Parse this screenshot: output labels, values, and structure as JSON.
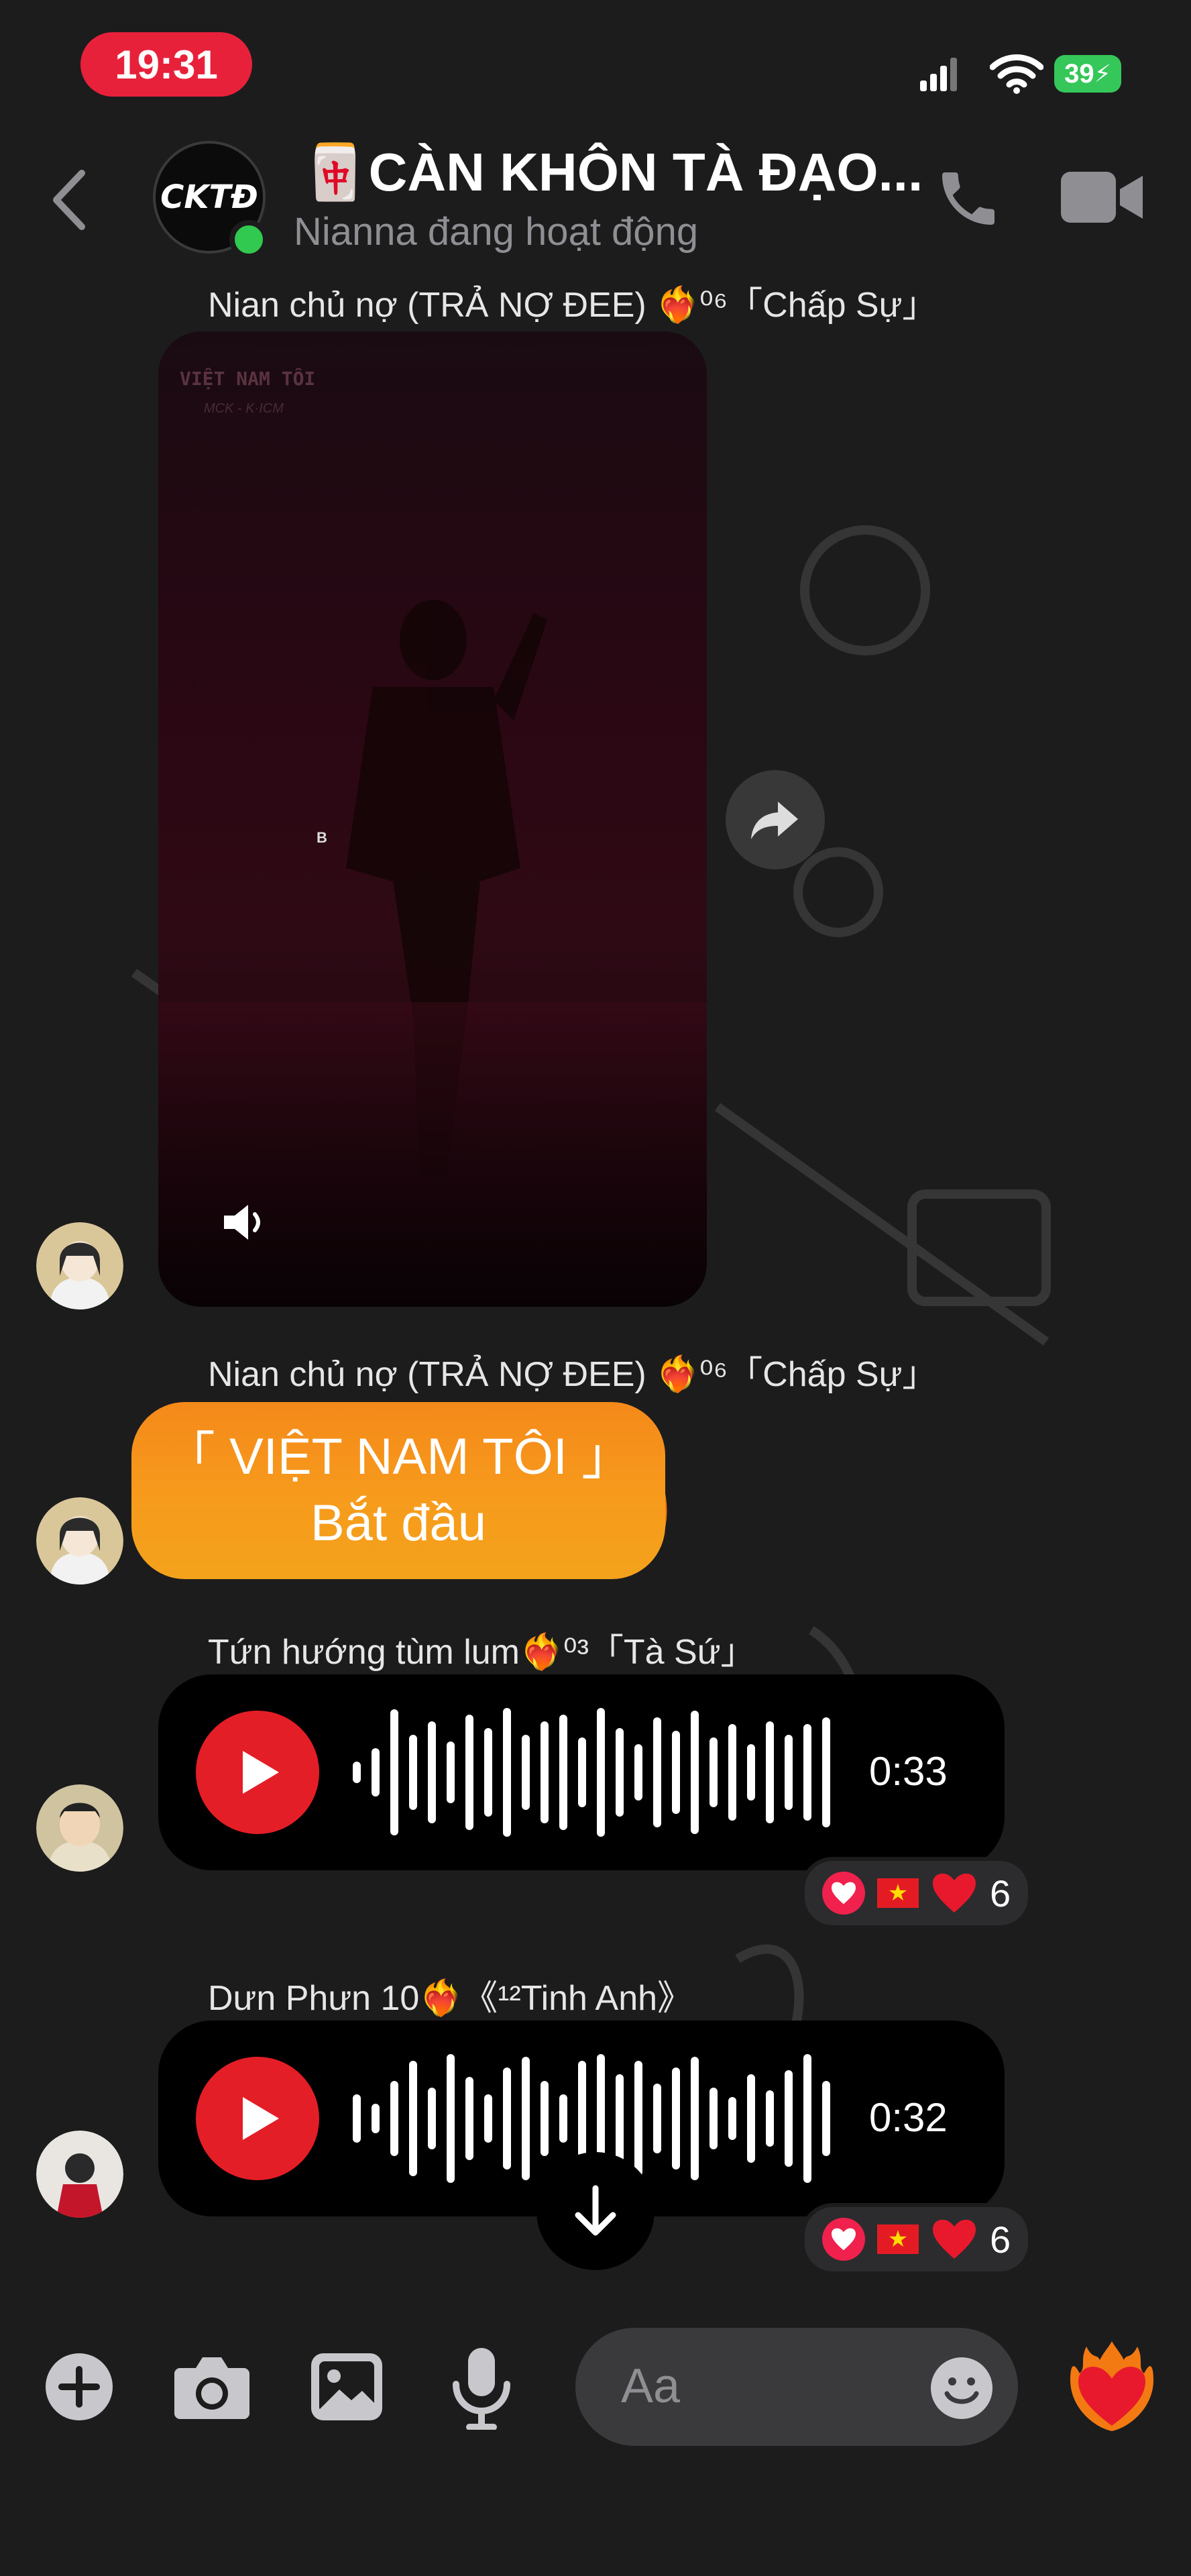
{
  "status_bar": {
    "time": "19:31",
    "battery": "39"
  },
  "header": {
    "logo_text": "CKTĐ",
    "title": "🀄️CÀN KHÔN TÀ ĐẠO...",
    "subtitle": "Nianna đang hoạt động"
  },
  "messages": [
    {
      "sender": "Nian chủ nợ (TRẢ NỢ ĐEE) ❤️‍🔥⁰⁶「Chấp Sự」",
      "type": "video",
      "video_caption": "VIỆT NAM TÔI",
      "video_sub": "MCK - K·ICM",
      "video_mark": "B"
    },
    {
      "sender": "Nian chủ nợ (TRẢ NỢ ĐEE) ❤️‍🔥⁰⁶「Chấp Sự」",
      "type": "text",
      "line1": "「 VIỆT NAM TÔI 」",
      "line2": "Bắt đầu"
    },
    {
      "sender": "Tứn hướng tùm lum❤️‍🔥⁰³「Tà Sứ」",
      "type": "voice",
      "duration": "0:33",
      "reaction_count": "6"
    },
    {
      "sender": "Dưn Phưn 10❤️‍🔥《¹²Tinh Anh》",
      "type": "voice",
      "duration": "0:32",
      "reaction_count": "6"
    }
  ],
  "composer": {
    "placeholder": "Aa"
  },
  "colors": {
    "accent": "#e41e26",
    "online": "#31c94f",
    "bubble": "#f79b1c"
  }
}
